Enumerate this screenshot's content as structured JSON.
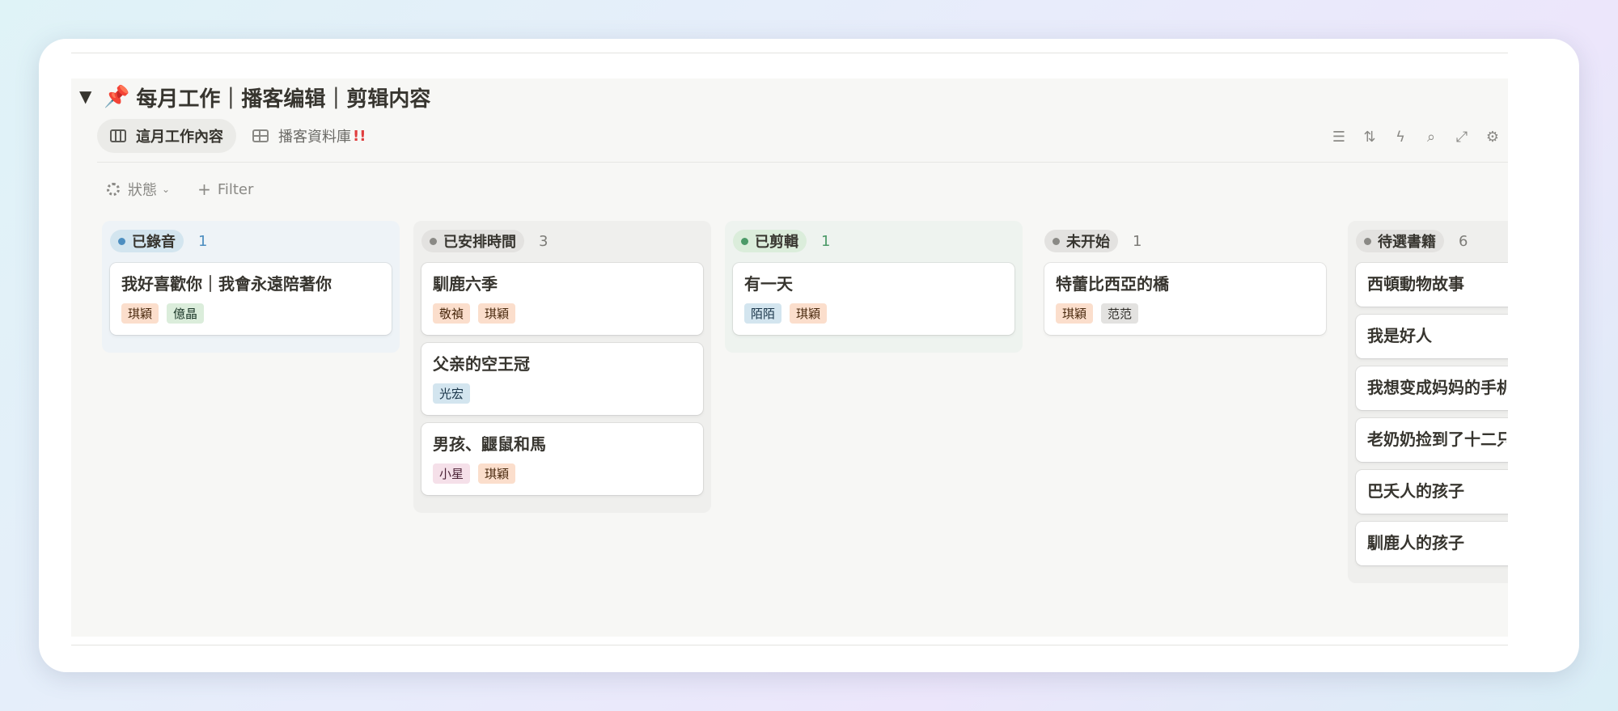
{
  "section": {
    "toggle": "▼",
    "emoji": "📌",
    "title": "每月工作｜播客编辑｜剪辑内容"
  },
  "tabs": [
    {
      "label": "這月工作內容",
      "active": true,
      "icon": "board-icon"
    },
    {
      "label": "播客資料庫",
      "suffix": "!!",
      "active": false,
      "icon": "table-icon"
    }
  ],
  "toolbar": {
    "icons": [
      "filter-lines-icon",
      "sort-icon",
      "lightning-icon",
      "search-icon",
      "expand-icon",
      "settings-sliders-icon"
    ],
    "glyphs": [
      "☰",
      "⇅",
      "ϟ",
      "⌕",
      "⤢",
      "⚙"
    ]
  },
  "filters": {
    "status_label": "狀態",
    "add_filter": "Filter",
    "plus": "+"
  },
  "columns": [
    {
      "name": "已錄音",
      "count": "1",
      "colors": {
        "bg": "#eef3f7",
        "pill": "#d3e5ef",
        "dot": "#4d8ec0",
        "count": "#4d8ec0"
      },
      "cards": [
        {
          "title": "我好喜歡你｜我會永遠陪著你",
          "tags": [
            {
              "label": "琪穎",
              "tone": "orange"
            },
            {
              "label": "億晶",
              "tone": "green"
            }
          ]
        }
      ]
    },
    {
      "name": "已安排時間",
      "count": "3",
      "colors": {
        "bg": "#efefed",
        "pill": "#e3e2e0",
        "dot": "#8a8985",
        "count": "#7d7c78"
      },
      "cards": [
        {
          "title": "馴鹿六季",
          "tags": [
            {
              "label": "敬禎",
              "tone": "orange"
            },
            {
              "label": "琪穎",
              "tone": "orange"
            }
          ]
        },
        {
          "title": "父亲的空王冠",
          "tags": [
            {
              "label": "光宏",
              "tone": "blue"
            }
          ]
        },
        {
          "title": "男孩、鼴鼠和馬",
          "tags": [
            {
              "label": "小星",
              "tone": "pink"
            },
            {
              "label": "琪穎",
              "tone": "orange"
            }
          ]
        }
      ]
    },
    {
      "name": "已剪輯",
      "count": "1",
      "colors": {
        "bg": "#eef3ef",
        "pill": "#dbeddb",
        "dot": "#4c9a68",
        "count": "#4c9a68"
      },
      "cards": [
        {
          "title": "有一天",
          "tags": [
            {
              "label": "陌陌",
              "tone": "blue"
            },
            {
              "label": "琪穎",
              "tone": "orange"
            }
          ]
        }
      ]
    },
    {
      "name": "未开始",
      "count": "1",
      "colors": {
        "bg": "#f7f7f5",
        "pill": "#e3e2e0",
        "dot": "#8a8985",
        "count": "#7d7c78"
      },
      "cards": [
        {
          "title": "特蕾比西亞的橋",
          "tags": [
            {
              "label": "琪穎",
              "tone": "orange"
            },
            {
              "label": "范范",
              "tone": "gray"
            }
          ]
        }
      ]
    },
    {
      "name": "待選書籍",
      "count": "6",
      "colors": {
        "bg": "#efefed",
        "pill": "#e3e2e0",
        "dot": "#8a8985",
        "count": "#7d7c78"
      },
      "cards": [
        {
          "title": "西頓動物故事",
          "tags": []
        },
        {
          "title": "我是好人",
          "tags": []
        },
        {
          "title": "我想变成妈妈的手机",
          "tags": []
        },
        {
          "title": "老奶奶捡到了十二只",
          "tags": []
        },
        {
          "title": "巴夭人的孩子",
          "tags": []
        },
        {
          "title": "馴鹿人的孩子",
          "tags": []
        }
      ]
    }
  ]
}
